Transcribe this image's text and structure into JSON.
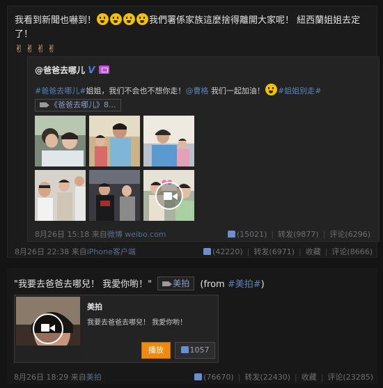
{
  "post1": {
    "text_a": "我看到新聞也嚇到！",
    "text_b": "我們署係家族這麼捨得離開大家呢！ 紐西蘭姐姐去定了！",
    "emoji_icons": [
      "surprised-emoji-icon",
      "surprised-emoji-icon",
      "surprised-emoji-icon",
      "surprised-emoji-icon"
    ],
    "victory_icons": [
      "victory-hand-icon",
      "victory-hand-icon",
      "victory-hand-icon",
      "victory-hand-icon"
    ],
    "repost": {
      "author": "@爸爸去哪儿",
      "hashtag": "#爸爸去哪儿#",
      "text_mid": "姐姐，我们不会也不想你走！",
      "mention": "@曹格",
      "text_end": "我们一起加油！",
      "hashtag2": "#姐姐别走#",
      "video_link": "《爸爸去哪儿》8...",
      "photos": [
        "photo-1",
        "photo-2",
        "photo-3",
        "photo-4",
        "photo-5",
        "photo-6-video"
      ],
      "time": "8月26日 15:18",
      "source_prefix": "来自",
      "source": "微博 weibo.com",
      "likes": "(15021)",
      "repost_label": "转发",
      "repost_count": "(9877)",
      "comment_label": "评论",
      "comment_count": "(6296)"
    },
    "time": "8月26日 22:38",
    "source_prefix": "来自",
    "source": "iPhone客户端",
    "likes": "(42220)",
    "repost_label": "转发",
    "repost_count": "(6971)",
    "fav_label": "收藏",
    "comment_label": "评论",
    "comment_count": "(8666)"
  },
  "post2": {
    "text_a": "\"我要去爸爸去哪兒！ 我愛你喲！\"",
    "meipai_link": "美拍",
    "from_prefix": "(from",
    "from_tag": "#美拍#",
    "from_suffix": ")",
    "card": {
      "title": "美拍",
      "desc": "我要去爸爸去哪兒！ 我愛你喲！",
      "play_label": "播放",
      "like_count": "1057"
    },
    "time": "8月26日 18:29",
    "source_prefix": "来自",
    "source": "美拍",
    "likes": "(76670)",
    "repost_label": "转发",
    "repost_count": "(22430)",
    "fav_label": "收藏",
    "comment_label": "评论",
    "comment_count": "(23285)"
  },
  "colors": {
    "background": "#141414",
    "link": "#5a82b8",
    "verified": "#4a7fe0",
    "play_button": "#ee8a10"
  }
}
